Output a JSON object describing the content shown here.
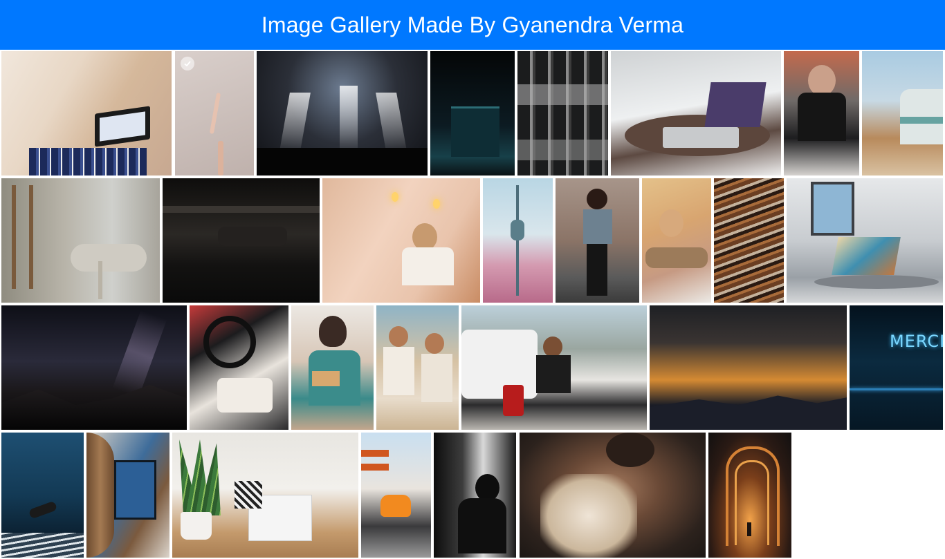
{
  "header": {
    "title": "Image Gallery Made By Gyanendra Verma"
  },
  "gallery": {
    "selected_index": 1,
    "images": [
      {
        "name": "person-laptop-couch-photo"
      },
      {
        "name": "hands-gesture-photo"
      },
      {
        "name": "concert-stage-photo"
      },
      {
        "name": "night-building-photo"
      },
      {
        "name": "building-facade-photo"
      },
      {
        "name": "laptop-on-tray-photo"
      },
      {
        "name": "smiling-woman-photo"
      },
      {
        "name": "trailer-desert-photo"
      },
      {
        "name": "interior-chairs-photo"
      },
      {
        "name": "dark-room-photo"
      },
      {
        "name": "woman-cafe-photo"
      },
      {
        "name": "tower-blossoms-photo"
      },
      {
        "name": "woman-street-photo"
      },
      {
        "name": "woman-lying-photo"
      },
      {
        "name": "marbled-pattern-photo"
      },
      {
        "name": "laptop-outdoor-photo"
      },
      {
        "name": "night-sky-mountains-photo"
      },
      {
        "name": "car-interior-photo"
      },
      {
        "name": "woman-reading-photo"
      },
      {
        "name": "men-beach-photo"
      },
      {
        "name": "man-truck-photo"
      },
      {
        "name": "sunset-clouds-photo"
      },
      {
        "name": "neon-sign-photo"
      },
      {
        "name": "underwater-diver-photo"
      },
      {
        "name": "art-gallery-photo"
      },
      {
        "name": "desk-plant-laptop-photo"
      },
      {
        "name": "orange-car-photo"
      },
      {
        "name": "silhouette-window-photo"
      },
      {
        "name": "woman-feather-photo"
      },
      {
        "name": "lit-corridor-photo"
      }
    ],
    "neon_text": "MERCI"
  },
  "colors": {
    "header_bg": "#0078ff",
    "header_text": "#ffffff"
  }
}
